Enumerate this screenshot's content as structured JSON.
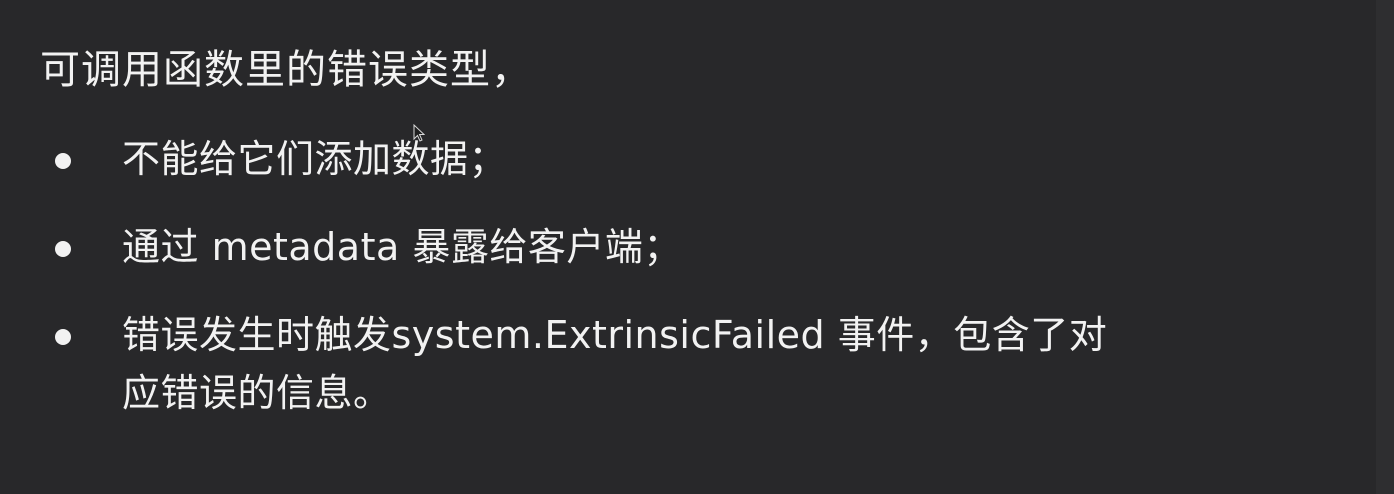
{
  "slide": {
    "heading": "可调用函数里的错误类型，",
    "bullets": [
      {
        "text": "不能给它们添加数据；"
      },
      {
        "text": "通过 metadata 暴露给客户端；"
      },
      {
        "text": "错误发生时触发system.ExtrinsicFailed 事件，包含了对应错误的信息。"
      }
    ]
  },
  "icons": {
    "bullet": "bullet-dot-icon",
    "cursor": "mouse-pointer-icon"
  },
  "colors": {
    "background": "#28282a",
    "text": "#f2f2f2"
  }
}
